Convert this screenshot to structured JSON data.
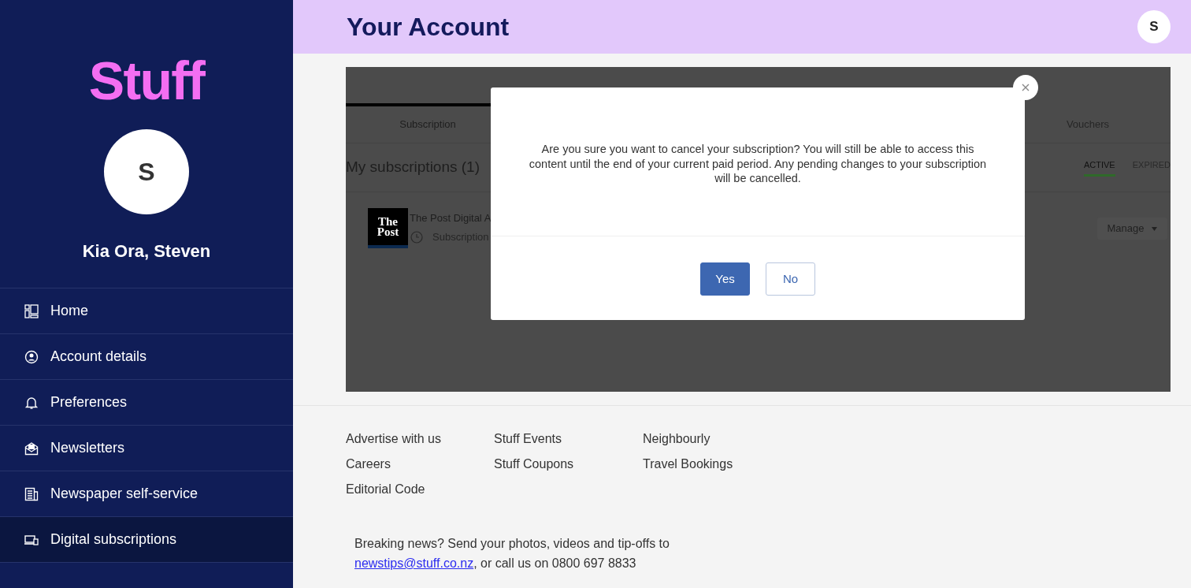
{
  "header": {
    "title": "Your Account",
    "avatar_initial": "S"
  },
  "sidebar": {
    "logo": "Stuff",
    "avatar_initial": "S",
    "greeting": "Kia Ora, Steven",
    "items": [
      {
        "label": "Home",
        "selected": false
      },
      {
        "label": "Account details",
        "selected": false
      },
      {
        "label": "Preferences",
        "selected": false
      },
      {
        "label": "Newsletters",
        "selected": false
      },
      {
        "label": "Newspaper self-service",
        "selected": false
      },
      {
        "label": "Digital subscriptions",
        "selected": true
      }
    ]
  },
  "background_page": {
    "tabs": [
      {
        "label": "Subscription",
        "selected": true
      },
      {
        "label": "Vouchers",
        "selected": false
      }
    ],
    "heading": "My subscriptions (1)",
    "filters": [
      {
        "label": "ACTIVE",
        "selected": true
      },
      {
        "label": "EXPIRED",
        "selected": false
      }
    ],
    "subscription": {
      "logo": "The Post",
      "name": "The Post Digital A",
      "detail": "Subscription",
      "action": "Manage"
    }
  },
  "dialog": {
    "message": "Are you sure you want to cancel your subscription? You will still be able to access this content until the end of your current paid period. Any pending changes to your subscription will be cancelled.",
    "buttons": [
      {
        "label": "Yes",
        "kind": "primary"
      },
      {
        "label": "No",
        "kind": "secondary"
      }
    ]
  },
  "footer": {
    "link_columns": [
      [
        "Advertise with us",
        "Careers",
        "Editorial Code"
      ],
      [
        "Stuff Events",
        "Stuff Coupons"
      ],
      [
        "Neighbourly",
        "Travel Bookings"
      ]
    ],
    "tip_text": "Breaking news? Send your photos, videos and tip-offs to",
    "tip_email": "newstips@stuff.co.nz",
    "tip_after": ", or call us on 0800 697 8833"
  }
}
